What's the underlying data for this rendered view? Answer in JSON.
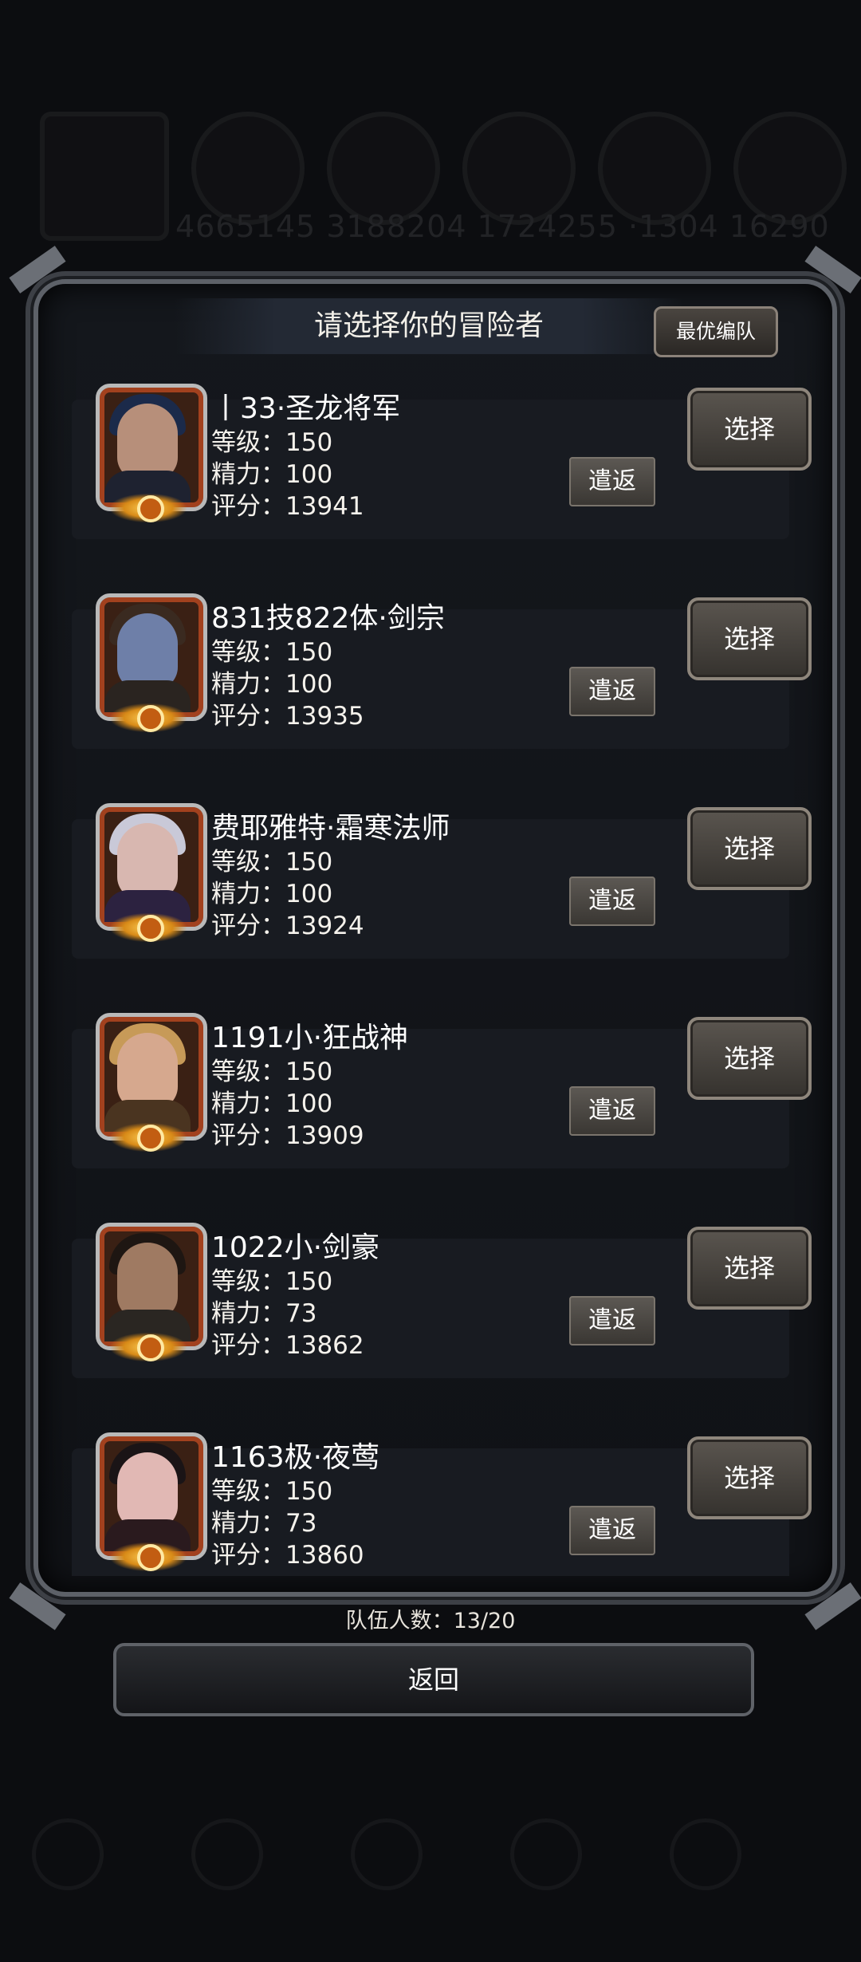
{
  "background": {
    "numbers": "4665145  3188204  1724255  ·1304  16290"
  },
  "dialog": {
    "title": "请选择你的冒险者",
    "best_team_label": "最优编队",
    "dismiss_label": "遣返",
    "select_label": "选择"
  },
  "adventurers": [
    {
      "name": "丨33·圣龙将军",
      "level": "等级：150",
      "energy": "精力：100",
      "score": "评分：13941",
      "hair": "#1b2a4a",
      "face": "#b78f7a",
      "torso": "#1e2230"
    },
    {
      "name": "831技822体·剑宗",
      "level": "等级：150",
      "energy": "精力：100",
      "score": "评分：13935",
      "hair": "#3a2a20",
      "face": "#6e7fa8",
      "torso": "#2a2420"
    },
    {
      "name": "费耶雅特·霜寒法师",
      "level": "等级：150",
      "energy": "精力：100",
      "score": "评分：13924",
      "hair": "#c9c9d8",
      "face": "#d8b7b0",
      "torso": "#2c2240"
    },
    {
      "name": "1191小·狂战神",
      "level": "等级：150",
      "energy": "精力：100",
      "score": "评分：13909",
      "hair": "#c79a58",
      "face": "#d6a88e",
      "torso": "#4a3420"
    },
    {
      "name": "1022小·剑豪",
      "level": "等级：150",
      "energy": "精力：73",
      "score": "评分：13862",
      "hair": "#1e1612",
      "face": "#9f7a62",
      "torso": "#2a2622"
    },
    {
      "name": "1163极·夜莺",
      "level": "等级：150",
      "energy": "精力：73",
      "score": "评分：13860",
      "hair": "#1a1416",
      "face": "#e1b8b4",
      "torso": "#2a1a1e"
    }
  ],
  "footer": {
    "team_count": "队伍人数：13/20",
    "back_label": "返回"
  }
}
